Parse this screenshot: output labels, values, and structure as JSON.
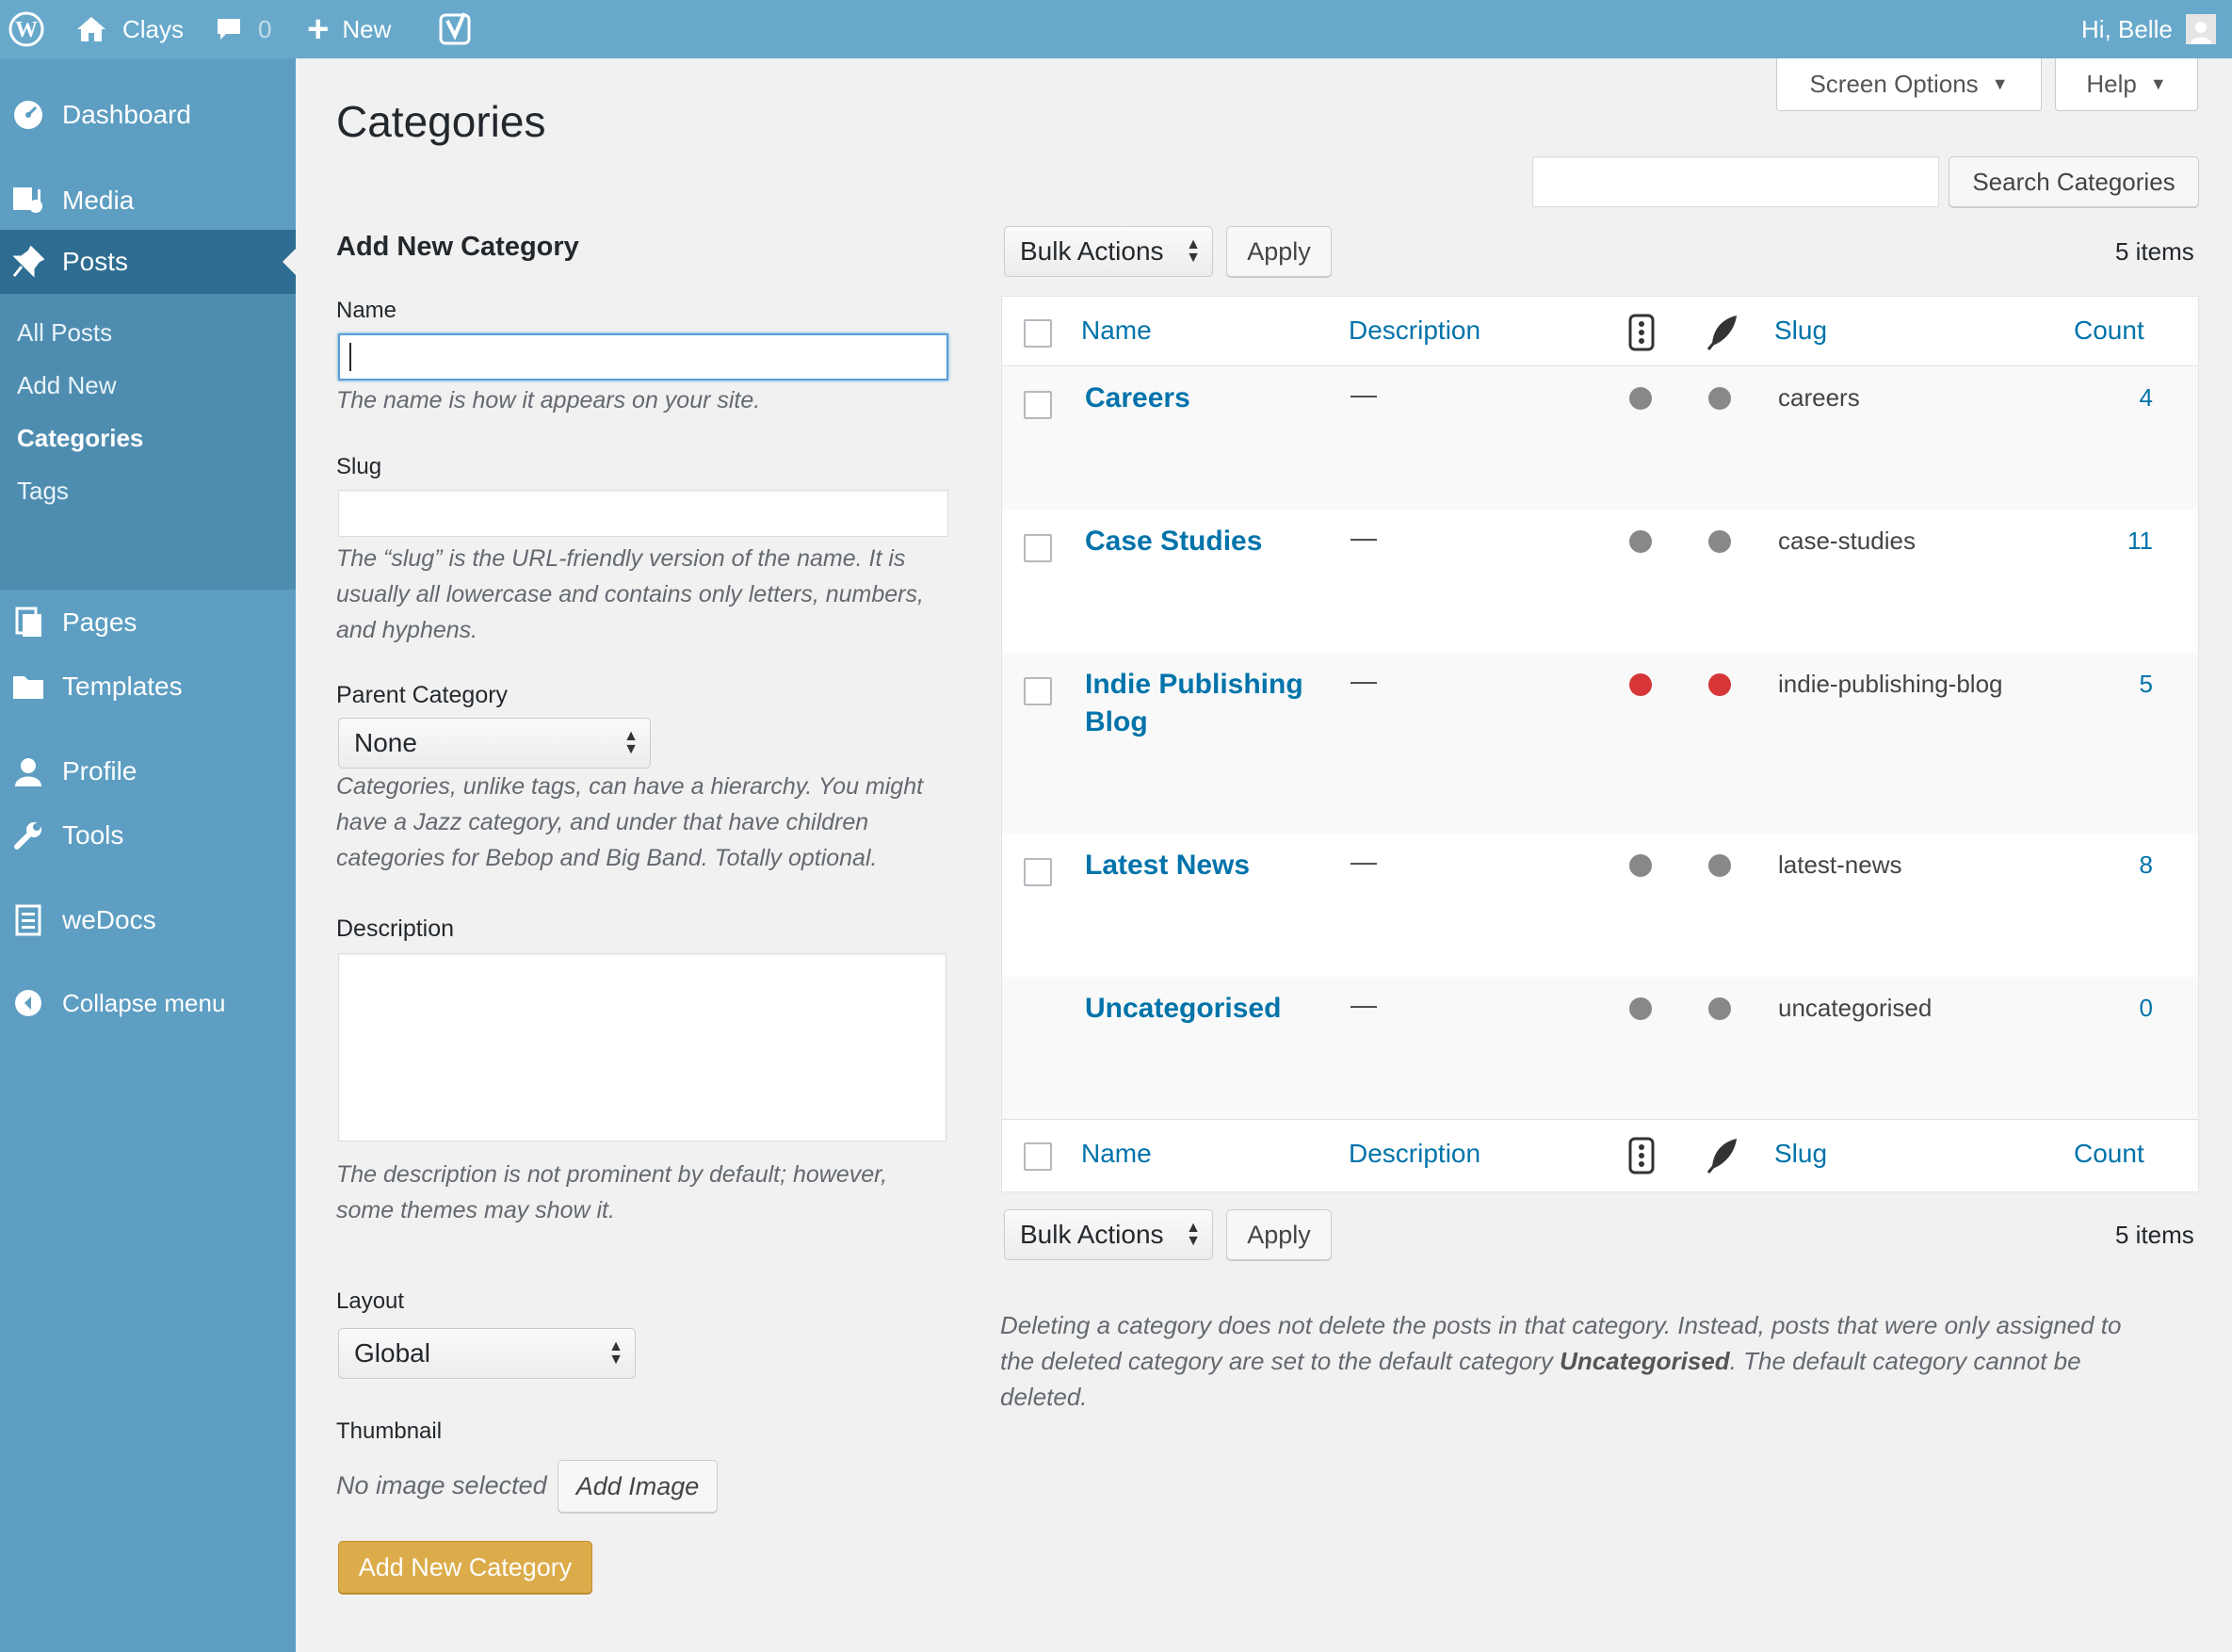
{
  "topbar": {
    "site_name": "Clays",
    "comments_count": "0",
    "new_label": "New",
    "greeting": "Hi, Belle"
  },
  "sidebar": {
    "items": [
      {
        "label": "Dashboard",
        "icon": "dashboard-icon"
      },
      {
        "label": "Media",
        "icon": "media-icon"
      },
      {
        "label": "Posts",
        "icon": "pin-icon"
      },
      {
        "label": "Pages",
        "icon": "pages-icon"
      },
      {
        "label": "Templates",
        "icon": "folder-icon"
      },
      {
        "label": "Profile",
        "icon": "user-icon"
      },
      {
        "label": "Tools",
        "icon": "wrench-icon"
      },
      {
        "label": "weDocs",
        "icon": "document-icon"
      },
      {
        "label": "Collapse menu",
        "icon": "collapse-icon"
      }
    ],
    "posts_submenu": [
      "All Posts",
      "Add New",
      "Categories",
      "Tags"
    ]
  },
  "header": {
    "page_title": "Categories",
    "screen_options": "Screen Options",
    "help": "Help"
  },
  "search": {
    "value": "",
    "button": "Search Categories"
  },
  "form": {
    "heading": "Add New Category",
    "name_label": "Name",
    "name_value": "",
    "name_help": "The name is how it appears on your site.",
    "slug_label": "Slug",
    "slug_value": "",
    "slug_help_1": "The “slug” is the URL-friendly version of the name. It is",
    "slug_help_2": "usually all lowercase and contains only letters, numbers,",
    "slug_help_3": "and hyphens.",
    "parent_label": "Parent Category",
    "parent_value": "None",
    "parent_help_1": "Categories, unlike tags, can have a hierarchy. You might",
    "parent_help_2": "have a Jazz category, and under that have children",
    "parent_help_3": "categories for Bebop and Big Band. Totally optional.",
    "description_label": "Description",
    "description_value": "",
    "description_help_1": "The description is not prominent by default; however,",
    "description_help_2": "some themes may show it.",
    "layout_label": "Layout",
    "layout_value": "Global",
    "thumbnail_label": "Thumbnail",
    "no_image": "No image selected",
    "add_image": "Add Image",
    "submit": "Add New Category"
  },
  "table": {
    "bulk_actions": "Bulk Actions",
    "apply": "Apply",
    "items_count": "5 items",
    "columns": {
      "name": "Name",
      "description": "Description",
      "slug": "Slug",
      "count": "Count"
    },
    "rows": [
      {
        "name_1": "Careers",
        "name_2": "",
        "description": "—",
        "slug": "careers",
        "count": "4",
        "status": "gray"
      },
      {
        "name_1": "Case Studies",
        "name_2": "",
        "description": "—",
        "slug": "case-studies",
        "count": "11",
        "status": "gray"
      },
      {
        "name_1": "Indie Publishing",
        "name_2": "Blog",
        "description": "—",
        "slug": "indie-publishing-blog",
        "count": "5",
        "status": "red"
      },
      {
        "name_1": "Latest News",
        "name_2": "",
        "description": "—",
        "slug": "latest-news",
        "count": "8",
        "status": "gray"
      },
      {
        "name_1": "Uncategorised",
        "name_2": "",
        "description": "—",
        "slug": "uncategorised",
        "count": "0",
        "status": "gray"
      }
    ]
  },
  "note": {
    "line_1": "Deleting a category does not delete the posts in that category. Instead, posts that were only assigned to",
    "line_2_a": "the deleted category are set to the default category ",
    "line_2_b": "Uncategorised",
    "line_2_c": ". The default category cannot be",
    "line_3": "deleted."
  },
  "colors": {
    "topbar": "#68a9cb",
    "sidebar": "#5d9ec2",
    "sidebar_active": "#2e6d91",
    "link": "#0073aa",
    "status_gray": "#888888",
    "status_red": "#d63638",
    "primary_button": "#dcac4a"
  }
}
